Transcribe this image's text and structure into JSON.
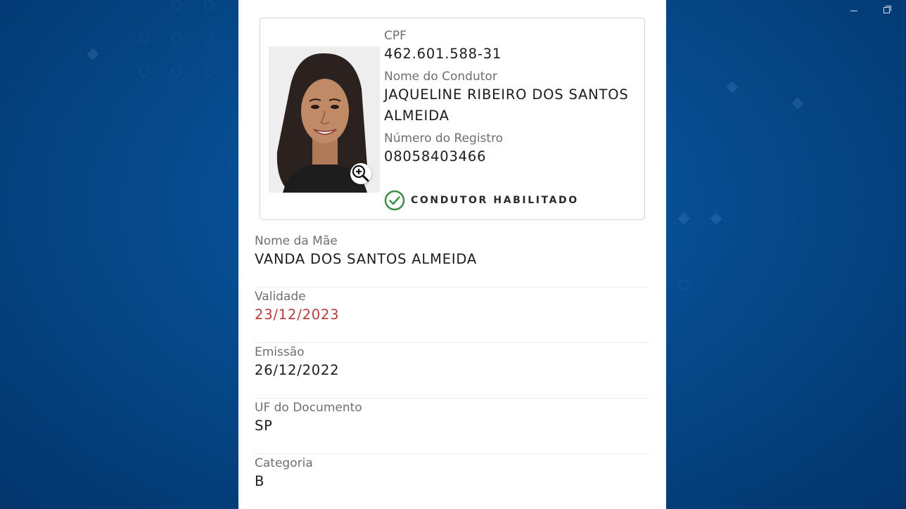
{
  "window": {
    "minimize_icon": "minimize-icon",
    "restore_icon": "restore-icon"
  },
  "card": {
    "photo_icon": "driver-photo",
    "zoom_icon": "zoom-in-icon",
    "cpf_label": "CPF",
    "cpf_value": "462.601.588-31",
    "name_label": "Nome do Condutor",
    "name_value_line1": "JAQUELINE RIBEIRO DOS SANTOS",
    "name_value_line2": "ALMEIDA",
    "registry_label": "Número do Registro",
    "registry_value": "08058403466",
    "status_icon": "check-circle-icon",
    "status_text": "CONDUTOR HABILITADO"
  },
  "fields": [
    {
      "label": "Nome da Mãe",
      "value": "VANDA DOS SANTOS ALMEIDA"
    },
    {
      "label": "Validade",
      "value": "23/12/2023"
    },
    {
      "label": "Emissão",
      "value": "26/12/2022"
    },
    {
      "label": "UF do Documento",
      "value": "SP"
    },
    {
      "label": "Categoria",
      "value": "B"
    }
  ],
  "colors": {
    "background_blue": "#064a8c",
    "expired_red": "#b83a3a",
    "status_green": "#3f8f4a"
  }
}
